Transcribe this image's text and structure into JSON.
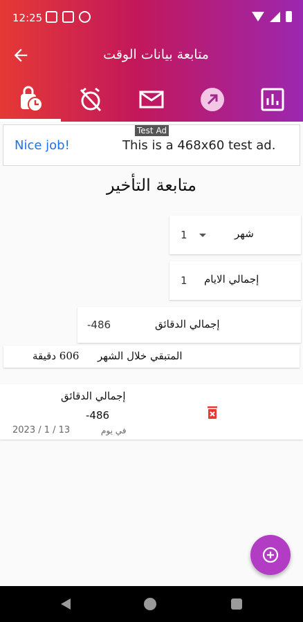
{
  "status_bar": {
    "time": "12:25"
  },
  "app_bar": {
    "title": "متابعة بيانات الوقت"
  },
  "tabs": [
    {
      "name": "late-tracking",
      "icon": "clock-bag-icon",
      "active": true
    },
    {
      "name": "alarm-off",
      "icon": "alarm-off-icon",
      "active": false
    },
    {
      "name": "mail",
      "icon": "mail-icon",
      "active": false
    },
    {
      "name": "share",
      "icon": "arrow-up-right-icon",
      "active": false
    },
    {
      "name": "reports",
      "icon": "bar-chart-icon",
      "active": false
    }
  ],
  "ad": {
    "tag": "Test Ad",
    "headline": "Nice job!",
    "text": "This is a 468x60 test ad."
  },
  "section_title": "متابعة التأخير",
  "form": {
    "month_label": "شهر",
    "month_value": "1",
    "days_label": "إجمالي الايام",
    "days_value": "1",
    "minutes_label": "إجمالي الدقائق",
    "minutes_value": "-486",
    "remaining_label": "المتبقي خلال الشهر",
    "remaining_value": "606 دقيقة"
  },
  "records": [
    {
      "label": "إجمالي الدقائق",
      "value": "-486",
      "date": "2023 / 1 / 13",
      "day_label": "في يوم"
    }
  ],
  "colors": {
    "gradient_start": "#e53935",
    "gradient_end": "#9c27b0",
    "fab": "#b33cc5",
    "delete": "#e53935"
  }
}
